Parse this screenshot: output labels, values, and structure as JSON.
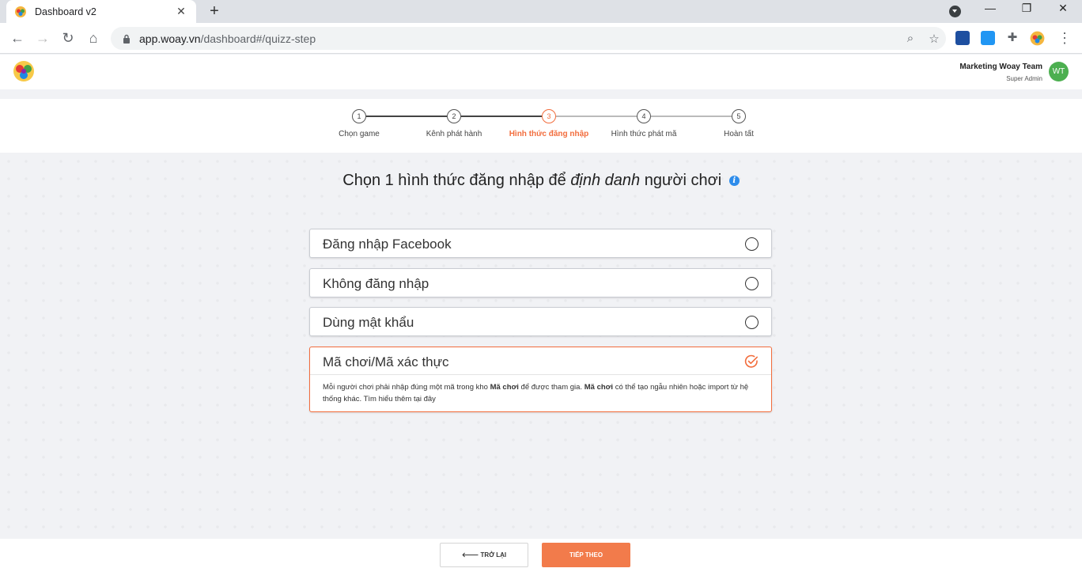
{
  "browser": {
    "tab_title": "Dashboard v2",
    "url_host": "app.woay.vn",
    "url_path": "/dashboard#/quizz-step"
  },
  "header": {
    "user_name": "Marketing Woay Team",
    "user_role": "Super Admin",
    "avatar_initials": "WT"
  },
  "stepper": {
    "steps": [
      {
        "number": "1",
        "label": "Chọn game"
      },
      {
        "number": "2",
        "label": "Kênh phát hành"
      },
      {
        "number": "3",
        "label": "Hình thức đăng nhập"
      },
      {
        "number": "4",
        "label": "Hình thức phát mã"
      },
      {
        "number": "5",
        "label": "Hoàn tất"
      }
    ],
    "active_step": 3
  },
  "main": {
    "heading_prefix": "Chọn 1 hình thức đăng nhập để ",
    "heading_emphasis": "định danh",
    "heading_suffix": " người chơi",
    "options": [
      {
        "label": "Đăng nhập Facebook",
        "selected": false
      },
      {
        "label": "Không đăng nhập",
        "selected": false
      },
      {
        "label": "Dùng mật khẩu",
        "selected": false
      },
      {
        "label": "Mã chơi/Mã xác thực",
        "selected": true
      }
    ],
    "selected_desc": {
      "part1": "Mỗi người chơi phải nhập đúng một mã trong kho ",
      "bold1": "Mã chơi",
      "part2": " để được tham gia. ",
      "bold2": "Mã chơi",
      "part3": " có thể tạo ngẫu nhiên hoặc import từ hệ thống khác. Tìm hiểu thêm tại đây"
    }
  },
  "footer": {
    "back_label": "TRỞ LẠI",
    "next_label": "TIẾP THEO"
  },
  "colors": {
    "accent": "#f26d3d",
    "info": "#2d8ceb",
    "avatar": "#4caf50"
  }
}
